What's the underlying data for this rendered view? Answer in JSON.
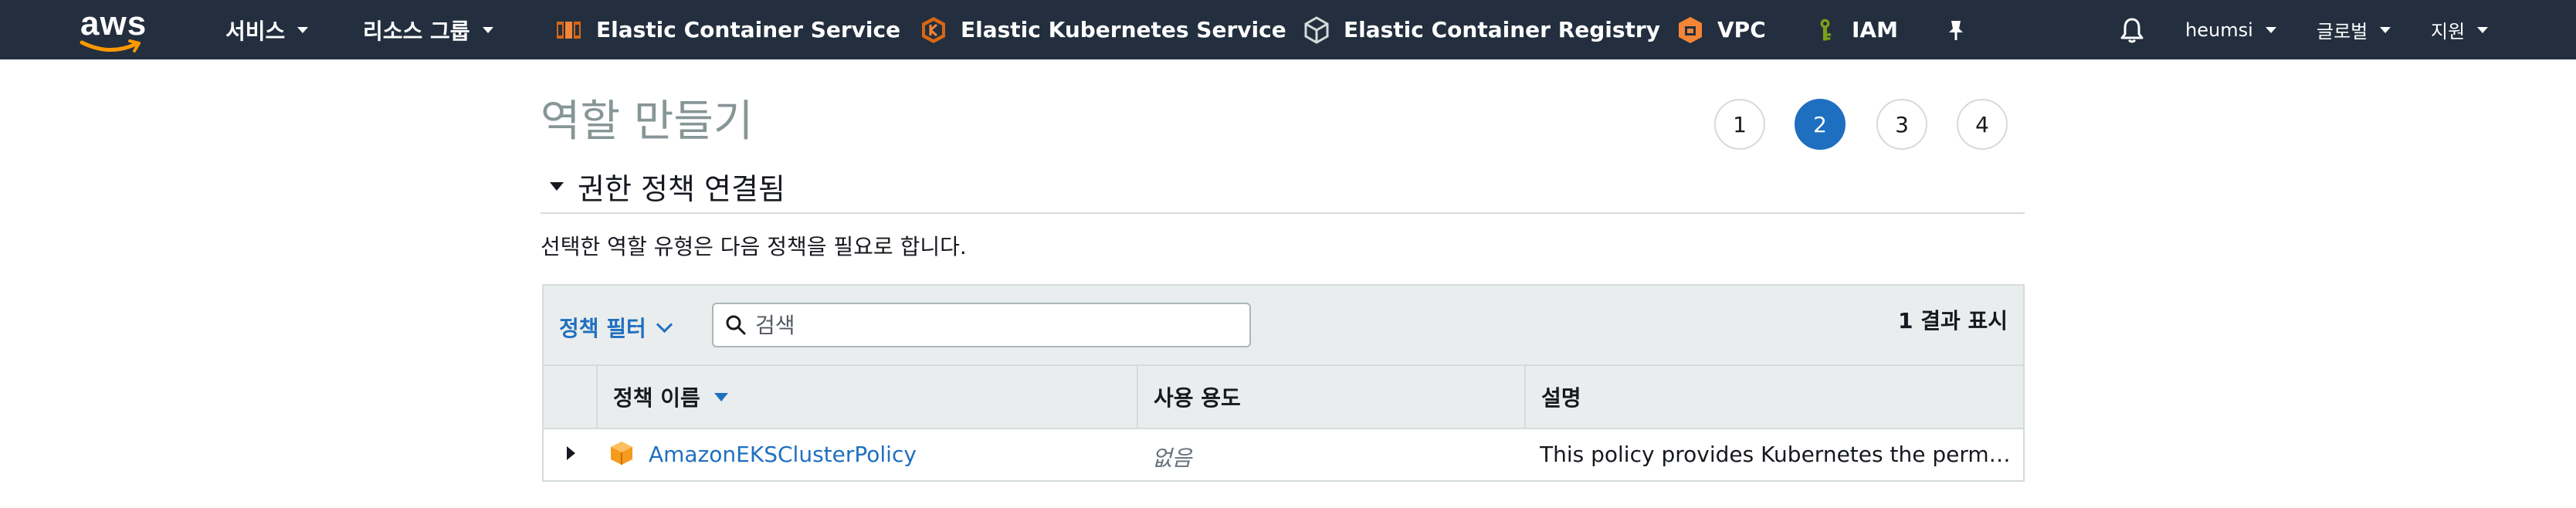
{
  "colors": {
    "nav_bg": "#232f3e",
    "accent": "#1f6fc0",
    "aws_orange": "#ff9900",
    "muted_title": "#879596"
  },
  "nav": {
    "logo": "aws",
    "services": "서비스",
    "resource_groups": "리소스 그룹",
    "pinned": [
      {
        "label": "Elastic Container Service",
        "icon": "ecs-icon"
      },
      {
        "label": "Elastic Kubernetes Service",
        "icon": "eks-icon"
      },
      {
        "label": "Elastic Container Registry",
        "icon": "ecr-icon"
      },
      {
        "label": "VPC",
        "icon": "vpc-icon"
      },
      {
        "label": "IAM",
        "icon": "iam-key-icon"
      }
    ],
    "pin_icon": "pushpin-icon",
    "bell_icon": "bell-icon",
    "user": "heumsi",
    "region": "글로벌",
    "support": "지원"
  },
  "page": {
    "title": "역할 만들기",
    "steps": [
      "1",
      "2",
      "3",
      "4"
    ],
    "active_step": 2
  },
  "section": {
    "title": "권한 정책 연결됨",
    "description": "선택한 역할 유형은 다음 정책을 필요로 합니다."
  },
  "toolbar": {
    "filter_label": "정책 필터",
    "search_placeholder": "검색",
    "result_count": "1 결과 표시"
  },
  "table": {
    "columns": [
      "정책 이름",
      "사용 용도",
      "설명"
    ],
    "rows": [
      {
        "name": "AmazonEKSClusterPolicy",
        "usage": "없음",
        "description": "This policy provides Kubernetes the permissions it requires to manage resources on your behalf."
      }
    ]
  }
}
